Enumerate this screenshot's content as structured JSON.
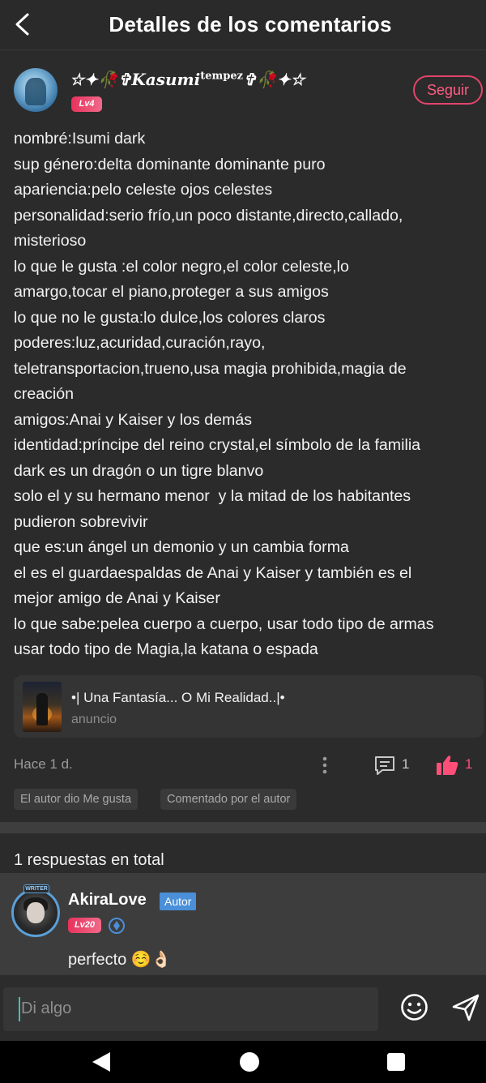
{
  "header": {
    "title": "Detalles de los comentarios",
    "back_icon": "back-arrow-icon"
  },
  "post": {
    "author_name": "☆✦🥀✞Kasumi",
    "author_name_sup": "tempez",
    "author_name_suffix": "✞🥀✦☆",
    "level": "Lv4",
    "follow_label": "Seguir",
    "body": "nombré:Isumi dark\nsup género:delta dominante dominante puro\napariencia:pelo celeste ojos celestes\npersonalidad:serio frío,un poco distante,directo,callado,\nmisterioso\nlo que le gusta :el color negro,el color celeste,lo\namargo,tocar el piano,proteger a sus amigos\nlo que no le gusta:lo dulce,los colores claros\npoderes:luz,acuridad,curación,rayo,\nteletransportacion,trueno,usa magia prohibida,magia de\ncreación\namigos:Anai y Kaiser y los demás\nidentidad:príncipe del reino crystal,el símbolo de la familia\ndark es un dragón o un tigre blanvo\nsolo el y su hermano menor  y la mitad de los habitantes\npudieron sobrevivir\nque es:un ángel un demonio y un cambia forma\nel es el guardaespaldas de Anai y Kaiser y también es el\nmejor amigo de Anai y Kaiser\nlo que sabe:pelea cuerpo a cuerpo, usar todo tipo de armas\nusar todo tipo de Magia,la katana o espada",
    "linked_card": {
      "title": "•| Una Fantasía... O Mi Realidad..|•",
      "subtitle": "anuncio"
    },
    "time": "Hace 1 d.",
    "reply_count": "1",
    "like_count": "1",
    "tags": [
      "El autor dio Me gusta",
      "Comentado por el autor"
    ]
  },
  "replies": {
    "total_label": "1 respuestas en total",
    "items": [
      {
        "user": "AkiraLove",
        "author_tag": "Autor",
        "level": "Lv20",
        "frame_label": "WRITER",
        "text": "perfecto ☺️👌🏻"
      }
    ]
  },
  "composer": {
    "placeholder": "Di algo"
  },
  "colors": {
    "accent": "#ff4f79",
    "author_tag": "#4a8fd8",
    "background": "#2b2b2b"
  }
}
